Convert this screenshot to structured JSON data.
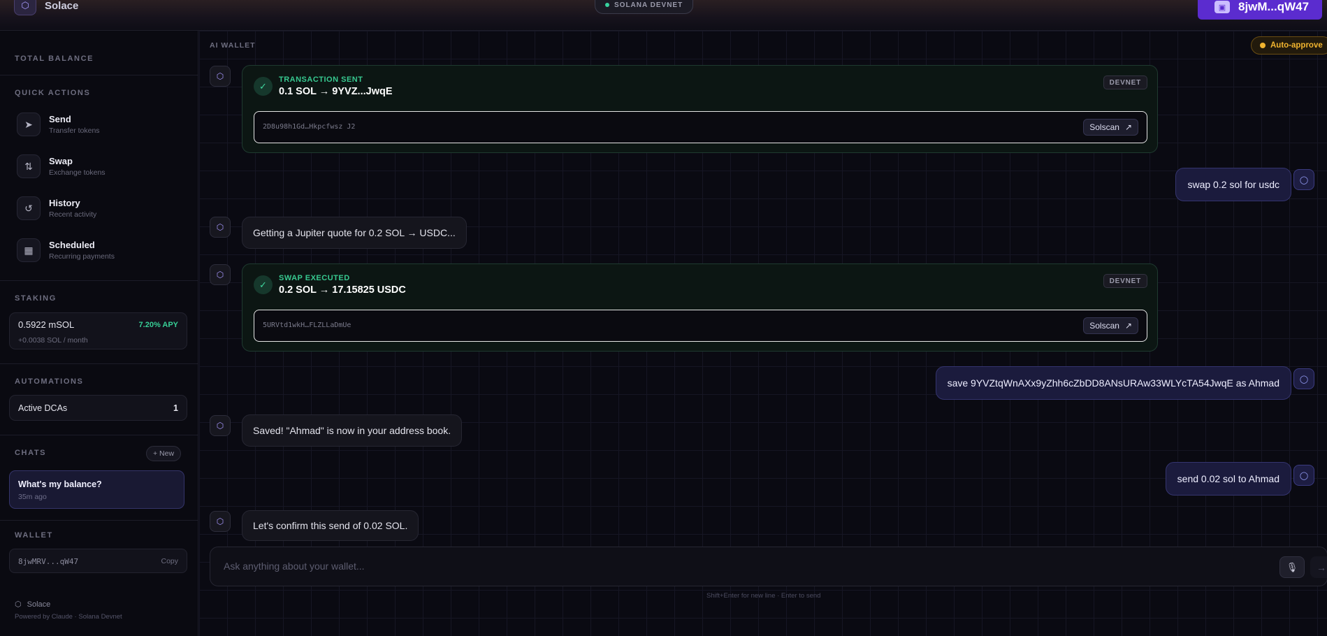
{
  "topbar": {
    "brand_name": "Solace",
    "network": "SOLANA DEVNET",
    "wallet_short": "8jwM...qW47"
  },
  "sidebar": {
    "total_balance_title": "TOTAL BALANCE",
    "quick_actions_title": "QUICK ACTIONS",
    "quick_actions": [
      {
        "label": "Send",
        "sub": "Transfer tokens",
        "icon": "send-icon"
      },
      {
        "label": "Swap",
        "sub": "Exchange tokens",
        "icon": "swap-icon"
      },
      {
        "label": "History",
        "sub": "Recent activity",
        "icon": "history-icon"
      },
      {
        "label": "Scheduled",
        "sub": "Recurring payments",
        "icon": "calendar-icon"
      }
    ],
    "staking_title": "STAKING",
    "staking": {
      "amount": "0.5922 mSOL",
      "apy": "7.20% APY",
      "yield": "+0.0038 SOL / month"
    },
    "automations_title": "AUTOMATIONS",
    "automations": {
      "label": "Active DCAs",
      "count": "1"
    },
    "chats_title": "CHATS",
    "new_label": "+ New",
    "chats": [
      {
        "title": "What's my balance?",
        "time": "35m ago"
      }
    ],
    "wallet_title": "WALLET",
    "wallet_address": "8jwMRV...qW47",
    "copy_label": "Copy",
    "footer_brand": "Solace",
    "footer_sub": "Powered by Claude · Solana Devnet"
  },
  "main": {
    "header": "AI WALLET",
    "auto_approve": "Auto-approve",
    "tx1": {
      "kicker": "TRANSACTION SENT",
      "title": "0.1 SOL → 9YVZ...JwqE",
      "network": "DEVNET",
      "hash": "2D8u98h1Gd…Hkpcfwsz J2",
      "link": "Solscan"
    },
    "user1": "swap 0.2 sol for usdc",
    "bot1": "Getting a Jupiter quote for 0.2 SOL → USDC...",
    "tx2": {
      "kicker": "SWAP EXECUTED",
      "title": "0.2 SOL → 17.15825 USDC",
      "network": "DEVNET",
      "hash": "5URVtd1wkH…FLZLLaDmUe",
      "link": "Solscan"
    },
    "user2": "save 9YVZtqWnAXx9yZhh6cZbDD8ANsURAw33WLYcTA54JwqE as Ahmad",
    "bot2": "Saved! \"Ahmad\" is now in your address book.",
    "user3": "send 0.02 sol to Ahmad",
    "bot3": "Let's confirm this send of 0.02 SOL.",
    "composer_placeholder": "Ask anything about your wallet...",
    "hint": "Shift+Enter for new line · Enter to send"
  }
}
